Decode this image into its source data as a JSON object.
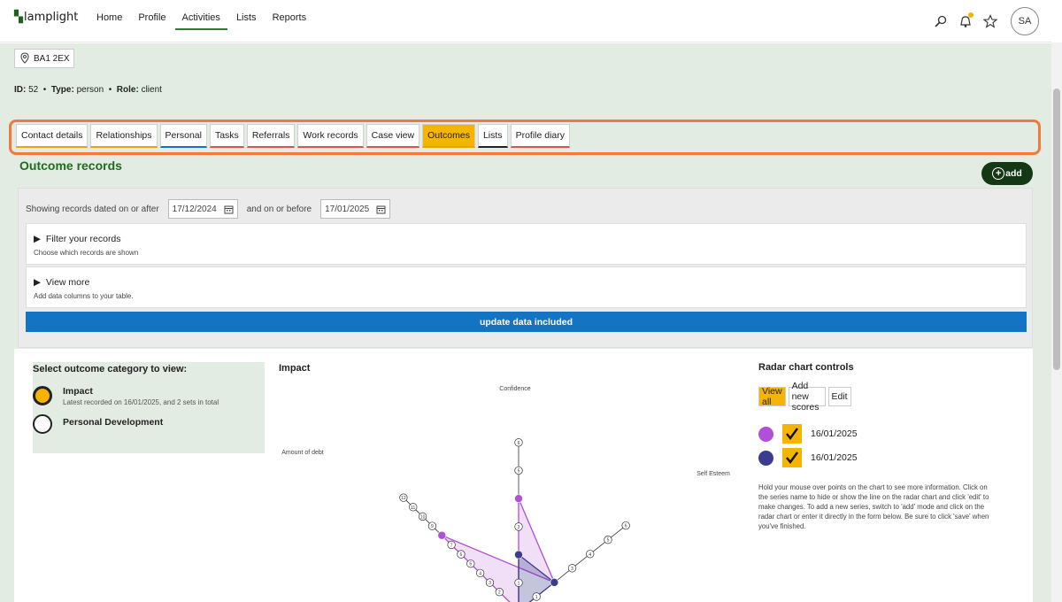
{
  "app": {
    "logo": "lamplight"
  },
  "nav": {
    "links": [
      "Home",
      "Profile",
      "Activities",
      "Lists",
      "Reports"
    ],
    "active": "Activities",
    "avatar": "SA",
    "accent": "#2e7d32"
  },
  "profile": {
    "postcode": "BA1 2EX",
    "id_label": "ID:",
    "id_value": "52",
    "type_label": "Type:",
    "type_value": "person",
    "role_label": "Role:",
    "role_value": "client"
  },
  "tabs": [
    {
      "label": "Contact details",
      "color": "#e8a400"
    },
    {
      "label": "Relationships",
      "color": "#e8a400"
    },
    {
      "label": "Personal",
      "color": "#1474c4"
    },
    {
      "label": "Tasks",
      "color": "#d9534f"
    },
    {
      "label": "Referrals",
      "color": "#d9534f"
    },
    {
      "label": "Work records",
      "color": "#d9534f"
    },
    {
      "label": "Case view",
      "color": "#d9534f"
    },
    {
      "label": "Outcomes",
      "color": "#e8a400",
      "active": true
    },
    {
      "label": "Lists",
      "color": "#222222"
    },
    {
      "label": "Profile diary",
      "color": "#d9534f"
    }
  ],
  "outcomes": {
    "title": "Outcome records",
    "add_label": "add",
    "date_from_label": "Showing records dated on or after",
    "date_from": "17/12/2024",
    "date_to_label": "and on or before",
    "date_to": "17/01/2025",
    "filter_head": "Filter your records",
    "filter_sub": "Choose which records are shown",
    "viewmore_head": "View more",
    "viewmore_sub": "Add data columns to your table.",
    "update_label": "update data included"
  },
  "categories": {
    "heading": "Select outcome category to view:",
    "items": [
      {
        "name": "Impact",
        "desc": "Latest recorded on 16/01/2025, and 2 sets in total",
        "selected": true
      },
      {
        "name": "Personal Development",
        "desc": "",
        "selected": false
      }
    ]
  },
  "chart_data": {
    "type": "radar",
    "title": "Impact",
    "axes": [
      "Confidence",
      "Self Esteem",
      "Amount of debt"
    ],
    "series": [
      {
        "values": [
          4,
          2,
          8
        ],
        "color": "#b04fd8"
      },
      {
        "values": [
          2,
          2,
          0
        ],
        "color": "#3b3b8f"
      }
    ]
  },
  "controls": {
    "heading": "Radar chart controls",
    "buttons": [
      "View all",
      "Add new scores",
      "Edit"
    ],
    "series": [
      {
        "date": "16/01/2025",
        "color": "#b04fd8"
      },
      {
        "date": "16/01/2025",
        "color": "#3b3b8f"
      }
    ],
    "help": "Hold your mouse over points on the chart to see more information. Click on the series name to hide or show the line on the radar chart and click 'edit' to make changes. To add a new series, switch to 'add' mode and click on the radar chart or enter it directly in the form below. Be sure to click 'save' when you've finished."
  }
}
